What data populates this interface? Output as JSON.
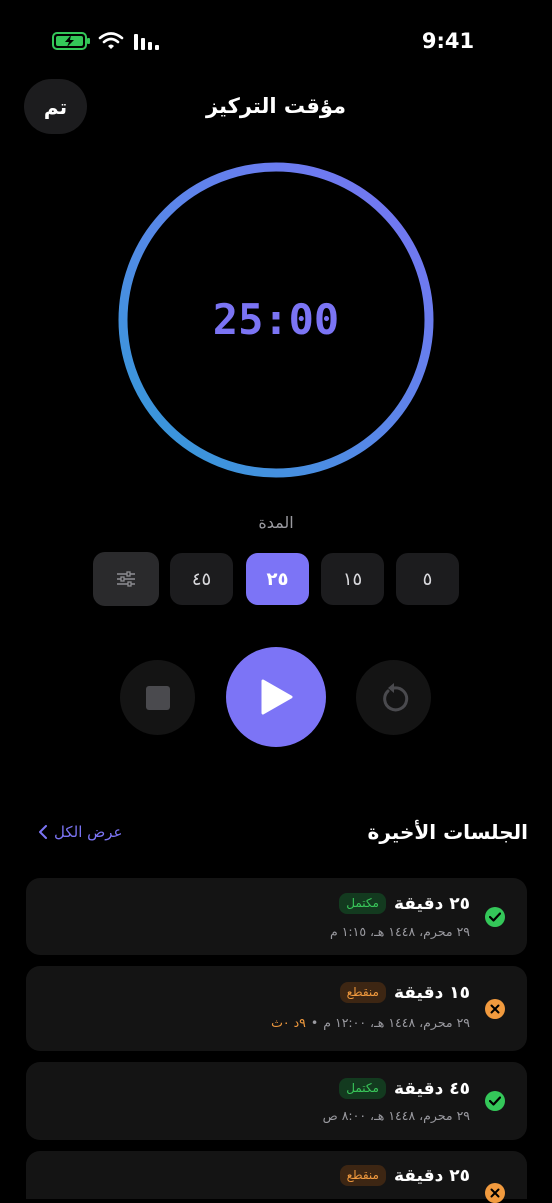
{
  "status_bar": {
    "time": "9:41",
    "icons": [
      "battery-charging-icon",
      "wifi-icon",
      "signal-icon"
    ]
  },
  "nav": {
    "done_label": "تم",
    "title": "مؤقت التركيز"
  },
  "timer": {
    "display": "25:00"
  },
  "duration": {
    "label": "المدة",
    "options": [
      "٥",
      "١٥",
      "٢٥",
      "٤٥"
    ],
    "selected": "٢٥"
  },
  "controls": {
    "play_icon": "play-icon",
    "stop_icon": "stop-icon",
    "reset_icon": "reset-icon"
  },
  "recent": {
    "title": "الجلسات الأخيرة",
    "see_all": "عرض الكل",
    "sessions": [
      {
        "duration": "٢٥ دقيقة",
        "status_label": "مكتمل",
        "status": "done",
        "date": "٢٩ محرم، ١٤٤٨ هـ، ١:١٥ م",
        "extra": ""
      },
      {
        "duration": "١٥ دقيقة",
        "status_label": "منقطع",
        "status": "cut",
        "date": "٢٩ محرم، ١٤٤٨ هـ، ١٢:٠٠ م",
        "extra": "٩د ٠ث"
      },
      {
        "duration": "٤٥ دقيقة",
        "status_label": "مكتمل",
        "status": "done",
        "date": "٢٩ محرم، ١٤٤٨ هـ، ٨:٠٠ ص",
        "extra": ""
      },
      {
        "duration": "٢٥ دقيقة",
        "status_label": "منقطع",
        "status": "cut",
        "date": "",
        "extra": ""
      }
    ]
  },
  "colors": {
    "accent": "#7C74F6",
    "success": "#34C759",
    "warning": "#F19A3E",
    "background": "#000000",
    "card": "#141414"
  }
}
